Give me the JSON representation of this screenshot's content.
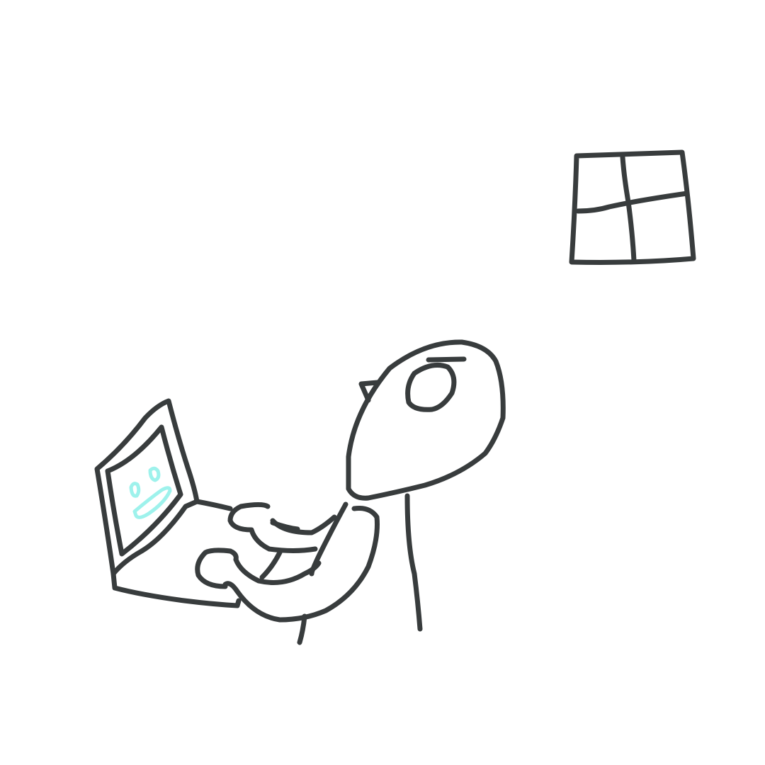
{
  "scene": {
    "background_color": "#ffffff",
    "ink_color": "#383c3d",
    "screen_doodle_color": "#9ef2ec",
    "subjects": [
      "window-icon",
      "person-figure",
      "laptop-icon"
    ]
  }
}
